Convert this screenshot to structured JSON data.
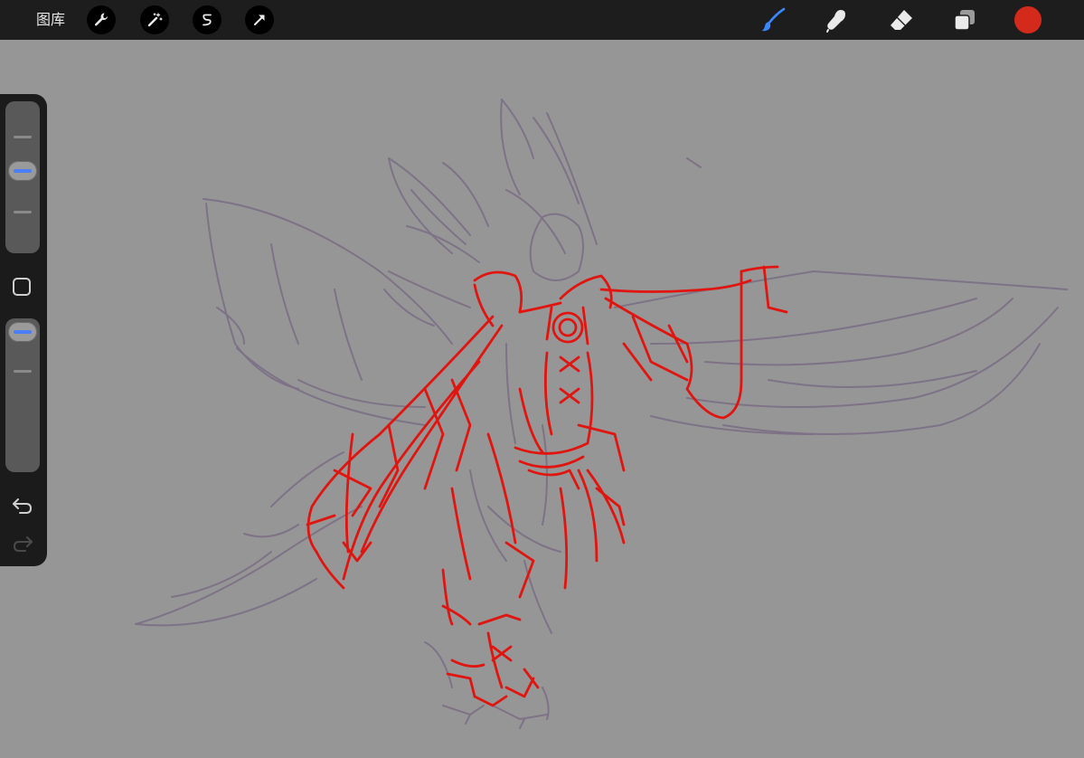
{
  "topbar": {
    "gallery_label": "图库",
    "advanced_tools": [
      {
        "name": "actions",
        "icon": "wrench-icon"
      },
      {
        "name": "adjustments",
        "icon": "magic-wand-icon"
      },
      {
        "name": "selection",
        "icon": "selection-s-icon"
      },
      {
        "name": "transform",
        "icon": "arrow-cursor-icon"
      }
    ],
    "tools": [
      {
        "name": "brush",
        "icon": "brush-icon",
        "active": true
      },
      {
        "name": "smudge",
        "icon": "smudge-finger-icon",
        "active": false
      },
      {
        "name": "eraser",
        "icon": "eraser-icon",
        "active": false
      },
      {
        "name": "layers",
        "icon": "layers-icon",
        "active": false
      }
    ],
    "current_color": "#d42a1c"
  },
  "sidebar": {
    "brush_size_level": 0.55,
    "opacity_level": 1.0,
    "modify_icon": "square-modify-icon",
    "undo_icon": "undo-arrow-icon",
    "redo_icon": "redo-arrow-icon",
    "redo_enabled": false
  },
  "canvas": {
    "background_color": "#969696",
    "sketch_colors": {
      "underlayer": "#7c6f86",
      "overlay": "#e0150f"
    }
  }
}
